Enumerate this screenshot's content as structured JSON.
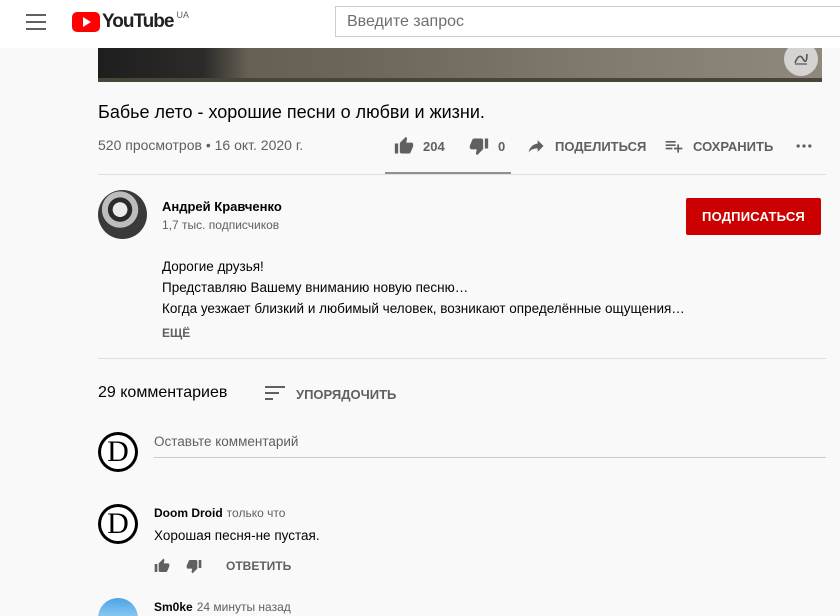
{
  "header": {
    "logo_text": "YouTube",
    "logo_country": "UA",
    "search_placeholder": "Введите запрос"
  },
  "video": {
    "title": "Бабье лето - хорошие песни о любви и жизни.",
    "views": "520 просмотров",
    "date": "16 окт. 2020 г.",
    "likes": "204",
    "dislikes": "0",
    "share_label": "ПОДЕЛИТЬСЯ",
    "save_label": "СОХРАНИТЬ"
  },
  "channel": {
    "name": "Андрей Кравченко",
    "subscribers": "1,7 тыс. подписчиков",
    "subscribe_label": "ПОДПИСАТЬСЯ"
  },
  "description": {
    "lines": [
      "Дорогие друзья!",
      "Представляю Вашему вниманию новую песню…",
      "Когда уезжает близкий и любимый человек, возникают определённые ощущения…"
    ],
    "more_label": "ЕЩЁ"
  },
  "comments": {
    "count_label": "29 комментариев",
    "sort_label": "УПОРЯДОЧИТЬ",
    "input_placeholder": "Оставьте комментарий",
    "items": [
      {
        "author": "Doom Droid",
        "time": "только что",
        "text": "Хорошая песня-не пустая.",
        "reply_label": "ОТВЕТИТЬ"
      },
      {
        "author": "Sm0ke",
        "time": "24 минуты назад"
      }
    ]
  },
  "colors": {
    "brand_red": "#ff0000",
    "subscribe_red": "#cc0000",
    "icon_gray": "#606060"
  },
  "icons": [
    "menu-icon",
    "youtube-logo-icon",
    "like-icon",
    "dislike-icon",
    "share-icon",
    "playlist-add-icon",
    "more-icon",
    "sort-icon"
  ]
}
